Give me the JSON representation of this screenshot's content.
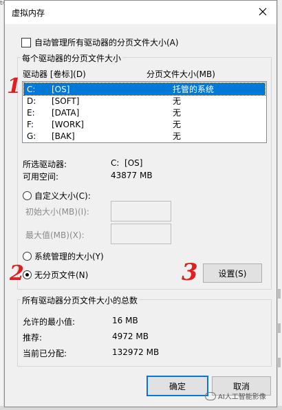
{
  "background_left_fragment": "t(",
  "dialog": {
    "title": "虚拟内存",
    "auto_manage_label": "自动管理所有驱动器的分页文件大小(A)",
    "per_drive_group_label": "每个驱动器的分页文件大小",
    "list_header_drive": "驱动器 [卷标](D)",
    "list_header_size": "分页文件大小(MB)",
    "drives": [
      {
        "letter": "C:",
        "label": "[OS]",
        "size": "托管的系统",
        "selected": true
      },
      {
        "letter": "D:",
        "label": "[SOFT]",
        "size": "无",
        "selected": false
      },
      {
        "letter": "E:",
        "label": "[DATA]",
        "size": "无",
        "selected": false
      },
      {
        "letter": "F:",
        "label": "[WORK]",
        "size": "无",
        "selected": false
      },
      {
        "letter": "G:",
        "label": "[BAK]",
        "size": "无",
        "selected": false
      }
    ],
    "selected_drive_label": "所选驱动器:",
    "selected_drive_value": "C:  [OS]",
    "free_space_label": "可用空间:",
    "free_space_value": "43877 MB",
    "custom_size_label": "自定义大小(C):",
    "initial_size_label": "初始大小(MB)(I):",
    "max_size_label": "最大值(MB)(X):",
    "system_managed_label": "系统管理的大小(Y)",
    "no_paging_label": "无分页文件(N)",
    "set_button": "设置(S)",
    "total_group_label": "所有驱动器分页文件大小的总数",
    "min_allowed_label": "允许的最小值:",
    "min_allowed_value": "16 MB",
    "recommended_label": "推荐:",
    "recommended_value": "4972 MB",
    "current_label": "当前已分配:",
    "current_value": "132972 MB",
    "ok_button": "确定",
    "cancel_button": "取消",
    "selected_radio": "no_paging"
  },
  "annotations": [
    "1",
    "2",
    "3"
  ],
  "watermark": "AI人工智能影像",
  "colors": {
    "selection": "#0078d7",
    "annotation": "#e02020"
  }
}
